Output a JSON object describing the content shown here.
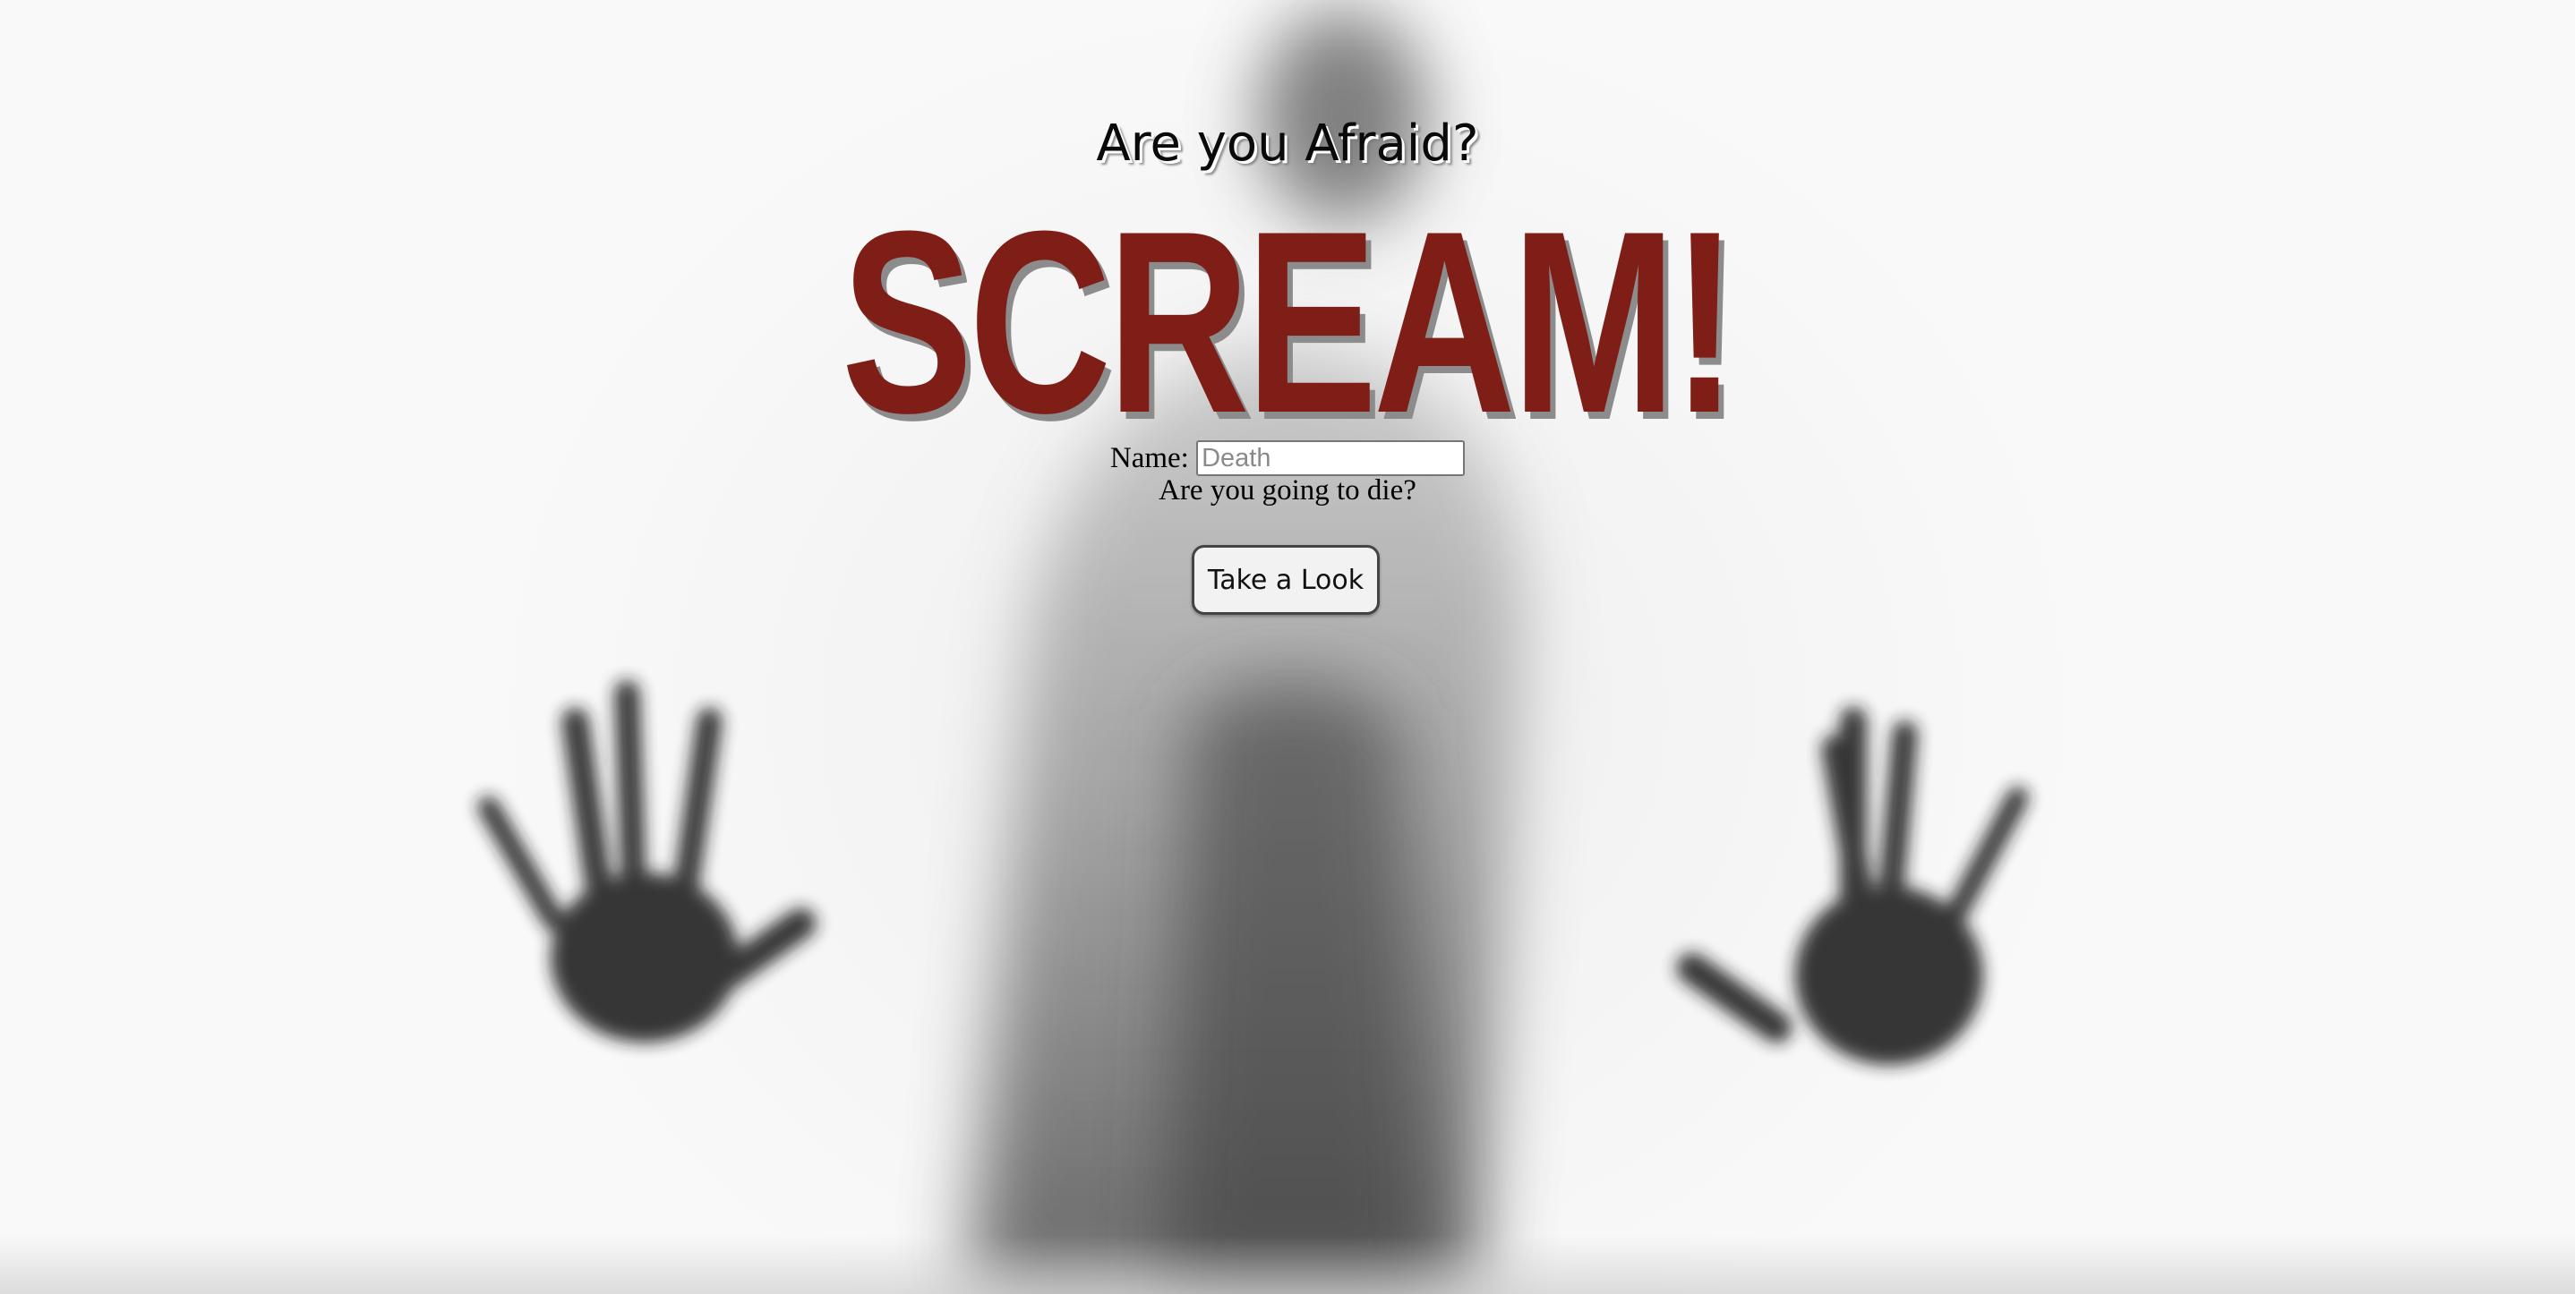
{
  "hero": {
    "tagline": "Are you Afraid?",
    "title": "SCREAM!",
    "title_color": "#7f1d17"
  },
  "form": {
    "name_label": "Name:",
    "name_placeholder": "Death",
    "question": "Are you going to die?",
    "button_label": "Take a Look"
  }
}
